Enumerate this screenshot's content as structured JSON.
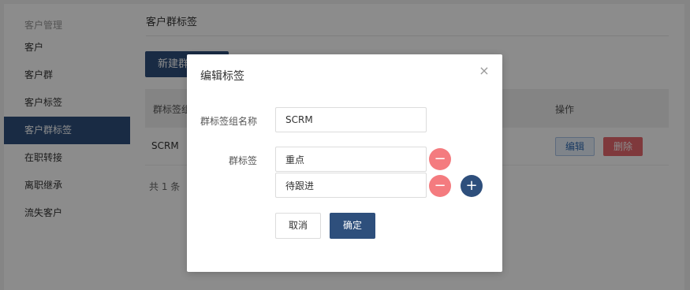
{
  "sidebar": {
    "group_label": "客户管理",
    "items": [
      {
        "label": "客户"
      },
      {
        "label": "客户群"
      },
      {
        "label": "客户标签"
      },
      {
        "label": "客户群标签"
      },
      {
        "label": "在职转接"
      },
      {
        "label": "离职继承"
      },
      {
        "label": "流失客户"
      }
    ],
    "active_index": 3
  },
  "page": {
    "title": "客户群标签",
    "new_button_label": "新建群标签",
    "table": {
      "headers": [
        "群标签组",
        "操作"
      ],
      "rows": [
        {
          "name": "SCRM",
          "edit_label": "编辑",
          "delete_label": "删除"
        }
      ]
    },
    "total_text": "共 1 条"
  },
  "modal": {
    "title": "编辑标签",
    "group_name_label": "群标签组名称",
    "group_name_value": "SCRM",
    "tags_label": "群标签",
    "tags": [
      {
        "value": "重点"
      },
      {
        "value": "待跟进"
      }
    ],
    "cancel_label": "取消",
    "confirm_label": "确定"
  },
  "colors": {
    "primary": "#2e4f7c",
    "danger": "#e8696e",
    "minus_button": "#f47b7f"
  },
  "icons": {
    "close": "close-icon",
    "minus": "minus-icon",
    "plus": "plus-icon"
  }
}
